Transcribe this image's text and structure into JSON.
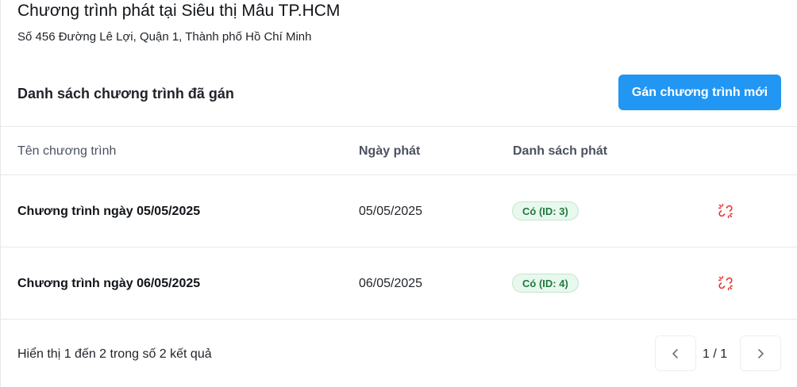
{
  "store": {
    "name": "Chương trình phát tại Siêu thị Mâu TP.HCM",
    "address": "Số 456 Đường Lê Lợi, Quận 1, Thành phố Hồ Chí Minh"
  },
  "section": {
    "title": "Danh sách chương trình đã gán",
    "assign_button": "Gán chương trình mới"
  },
  "table": {
    "headers": [
      "Tên chương trình",
      "Ngày phát",
      "Danh sách phát"
    ],
    "rows": [
      {
        "name": "Chương trình ngày 05/05/2025",
        "date": "05/05/2025",
        "playlist": "Có (ID: 3)",
        "action_icon": "unlink-icon"
      },
      {
        "name": "Chương trình ngày 06/05/2025",
        "date": "06/05/2025",
        "playlist": "Có (ID: 4)",
        "action_icon": "unlink-icon"
      }
    ]
  },
  "footer": {
    "summary": "Hiển thị 1 đến 2 trong số 2 kết quả",
    "page_info": "1 / 1",
    "prev_icon": "chevron-left-icon",
    "next_icon": "chevron-right-icon"
  },
  "colors": {
    "primary": "#2196f3",
    "badge_bg": "#e9f8ee",
    "badge_text": "#1f7a3e",
    "danger": "#e53935"
  }
}
